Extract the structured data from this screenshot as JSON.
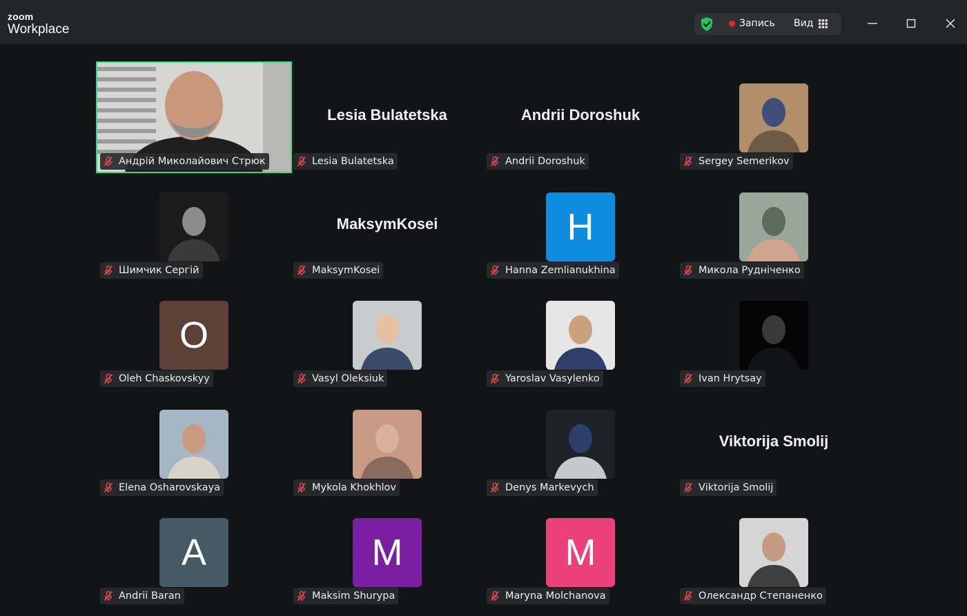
{
  "app": {
    "logo_top": "zoom",
    "logo_main": "Workplace"
  },
  "toolbar": {
    "record_label": "Запись",
    "view_label": "Вид",
    "shield_icon": "shield-check-icon",
    "grid_icon": "grid-icon",
    "record_color": "#e02828",
    "shield_color": "#22c55e"
  },
  "window_controls": {
    "minimize_icon": "minimize-icon",
    "maximize_icon": "maximize-icon",
    "close_icon": "close-icon"
  },
  "active_speaker_color": "#2fe07b",
  "participants": [
    {
      "name": "Андрій Миколайович Стрюк",
      "display": "video",
      "active_speaker": true
    },
    {
      "name": "Lesia Bulatetska",
      "display": "name",
      "big_name": "Lesia Bulatetska"
    },
    {
      "name": "Andrii Doroshuk",
      "display": "name",
      "big_name": "Andrii Doroshuk"
    },
    {
      "name": "Sergey Semerikov",
      "display": "photo"
    },
    {
      "name": "Шимчик Сергій",
      "display": "photo"
    },
    {
      "name": "MaksymKosei",
      "display": "name",
      "big_name": "MaksymKosei"
    },
    {
      "name": "Hanna Zemlianukhina",
      "display": "letter",
      "letter": "H",
      "color": "#0e8de0"
    },
    {
      "name": "Микола Рудніченко",
      "display": "photo"
    },
    {
      "name": "Oleh Chaskovskyy",
      "display": "letter",
      "letter": "O",
      "color": "#5d4037"
    },
    {
      "name": "Vasyl Oleksiuk",
      "display": "photo"
    },
    {
      "name": "Yaroslav Vasylenko",
      "display": "photo"
    },
    {
      "name": "Ivan Hrytsay",
      "display": "photo"
    },
    {
      "name": "Elena Osharovskaya",
      "display": "photo"
    },
    {
      "name": "Mykola Khokhlov",
      "display": "photo"
    },
    {
      "name": "Denys Markevych",
      "display": "photo"
    },
    {
      "name": "Viktorija Smolij",
      "display": "name",
      "big_name": "Viktorija Smolij"
    },
    {
      "name": "Andrii Baran",
      "display": "letter",
      "letter": "A",
      "color": "#455a64"
    },
    {
      "name": "Maksim Shurypa",
      "display": "letter",
      "letter": "M",
      "color": "#7b1fa2"
    },
    {
      "name": "Maryna Molchanova",
      "display": "letter",
      "letter": "M",
      "color": "#ec407a"
    },
    {
      "name": "Олександр Степаненко",
      "display": "photo"
    }
  ]
}
